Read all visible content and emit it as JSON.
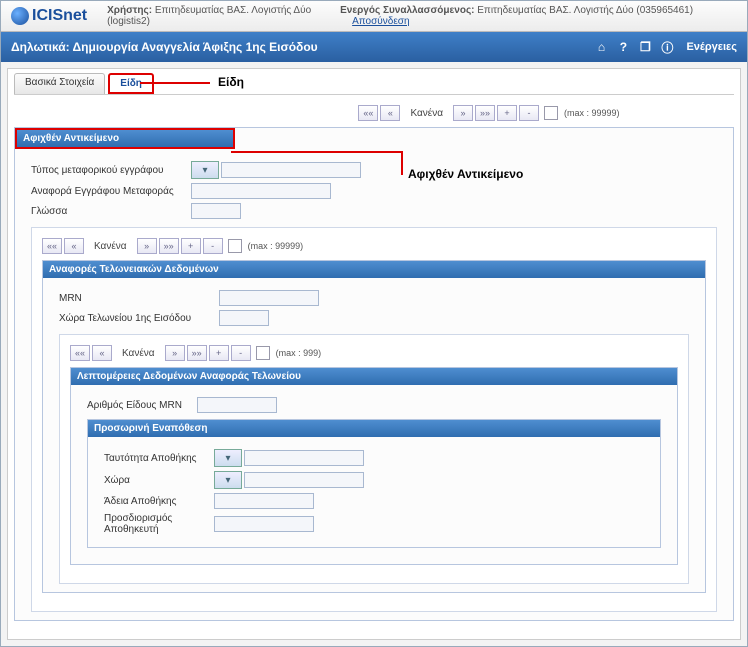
{
  "brand": "ICISnet",
  "top": {
    "user_label": "Χρήστης:",
    "user_val": "Επιτηδευματίας ΒΑΣ. Λογιστής Δύο (logistis2)",
    "active_label": "Ενεργός Συναλλασσόμενος:",
    "active_val": "Επιτηδευματίας ΒΑΣ. Λογιστής Δύο (035965461)",
    "logout": "Αποσύνδεση"
  },
  "title": "Δηλωτικά: Δημιουργία Αναγγελία Άφιξης 1ης Εισόδου",
  "actions_label": "Ενέργειες",
  "tabs": {
    "basic": "Βασικά Στοιχεία",
    "items": "Είδη"
  },
  "annot": {
    "tab": "Είδη",
    "section": "Αφιχθέν Αντικείμενο"
  },
  "pager": {
    "first": "««",
    "prev": "«",
    "none": "Κανένα",
    "next": "»",
    "last": "»»",
    "plus": "+",
    "minus": "-",
    "max99999": "(max : 99999)",
    "max999": "(max : 999)"
  },
  "sec1": {
    "title": "Αφιχθέν Αντικείμενο",
    "f1": "Τύπος μεταφορικού εγγράφου",
    "f2": "Αναφορά Εγγράφου Μεταφοράς",
    "f3": "Γλώσσα",
    "dd": "▾"
  },
  "sec2": {
    "title": "Αναφορές Τελωνειακών Δεδομένων",
    "f1": "MRN",
    "f2": "Χώρα Τελωνείου 1ης Εισόδου"
  },
  "sec3": {
    "title": "Λεπτομέρειες Δεδομένων Αναφοράς Τελωνείου",
    "f1": "Αριθμός Είδους MRN"
  },
  "sec4": {
    "title": "Προσωρινή Εναπόθεση",
    "f1": "Ταυτότητα Αποθήκης",
    "f2": "Χώρα",
    "f3": "Άδεια Αποθήκης",
    "f4": "Προσδιορισμός Αποθηκευτή"
  },
  "icons": {
    "home": "⌂",
    "help": "?",
    "copy": "❐",
    "info": "ⓘ"
  }
}
